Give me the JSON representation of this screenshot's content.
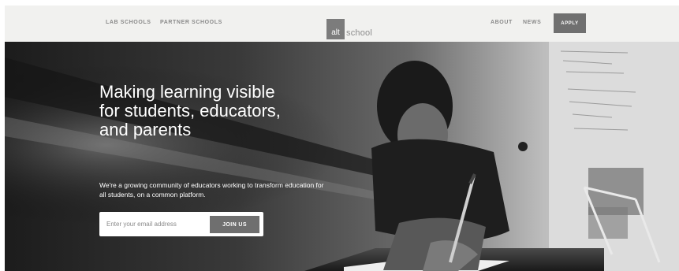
{
  "header": {
    "nav_left": [
      {
        "label": "LAB SCHOOLS"
      },
      {
        "label": "PARTNER SCHOOLS"
      }
    ],
    "logo": {
      "box_text": "alt",
      "text": "school"
    },
    "nav_right": [
      {
        "label": "ABOUT"
      },
      {
        "label": "NEWS"
      }
    ],
    "apply_label": "APPLY"
  },
  "hero": {
    "title": "Making learning visible for students, educators, and parents",
    "subtitle": "We're a growing community of educators working to transform education for all students, on a common platform.",
    "signup": {
      "email_placeholder": "Enter your email address",
      "join_label": "JOIN US"
    }
  },
  "colors": {
    "header_bg": "#f1f1ef",
    "button_gray": "#707070",
    "nav_text": "#8a8a8a"
  }
}
